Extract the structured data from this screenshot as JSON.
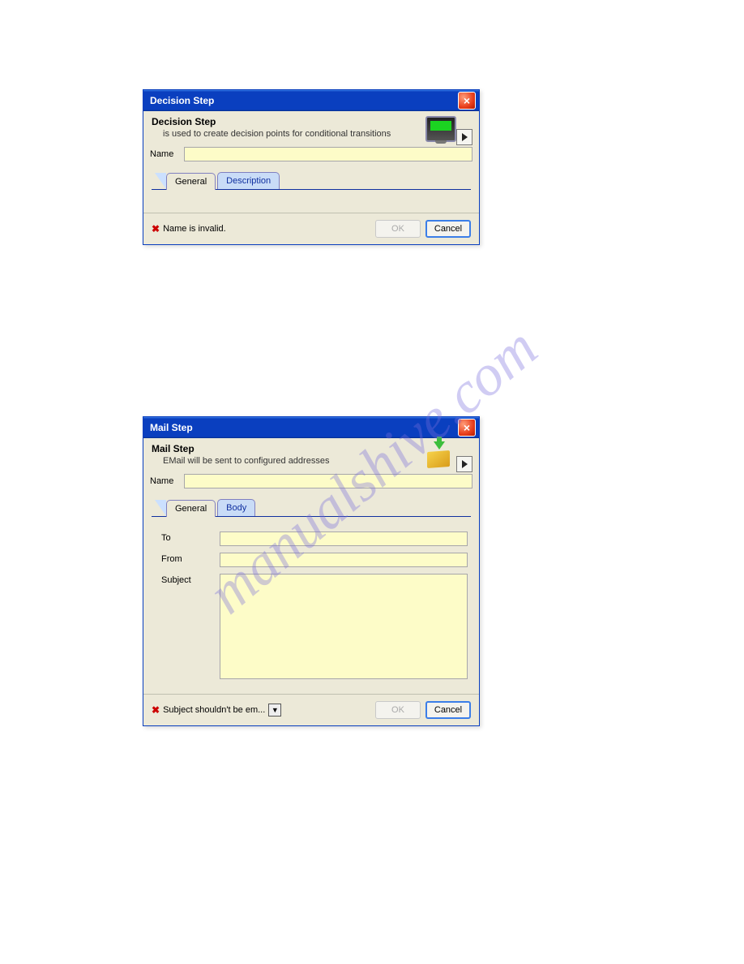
{
  "watermark": "manualshive.com",
  "dialog1": {
    "titlebar": "Decision Step",
    "header_title": "Decision Step",
    "header_desc": "is used to create decision points for conditional transitions",
    "name_label": "Name",
    "name_value": "",
    "tabs": {
      "general": "General",
      "description": "Description"
    },
    "error_text": "Name is invalid.",
    "ok_label": "OK",
    "cancel_label": "Cancel"
  },
  "dialog2": {
    "titlebar": "Mail Step",
    "header_title": "Mail Step",
    "header_desc": "EMail will be sent to configured addresses",
    "name_label": "Name",
    "name_value": "",
    "tabs": {
      "general": "General",
      "body": "Body"
    },
    "fields": {
      "to_label": "To",
      "to_value": "",
      "from_label": "From",
      "from_value": "",
      "subject_label": "Subject",
      "subject_value": ""
    },
    "error_text": "Subject shouldn't be em...",
    "ok_label": "OK",
    "cancel_label": "Cancel"
  }
}
